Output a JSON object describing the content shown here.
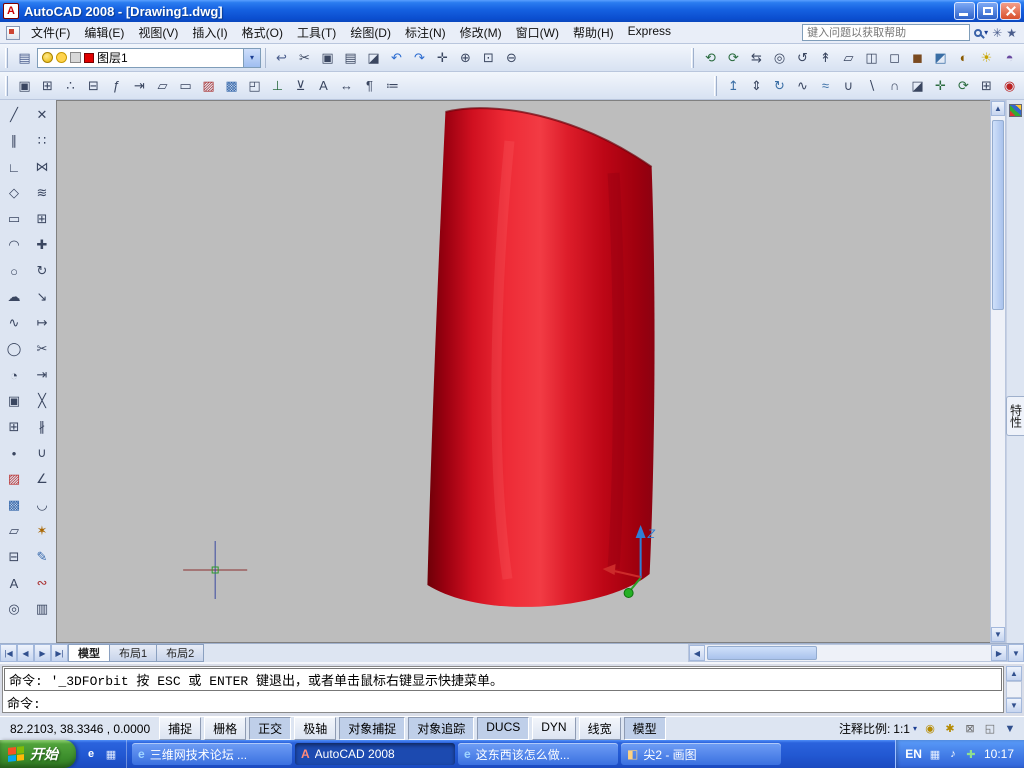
{
  "glyphs": {
    "up": "▲",
    "down": "▼",
    "left": "◀",
    "right": "▶",
    "caret": "▾"
  },
  "titlebar": {
    "app_icon_glyph": "A",
    "title": "AutoCAD 2008 - [Drawing1.dwg]"
  },
  "menubar": {
    "items": [
      {
        "name": "menu-file",
        "label": "文件(F)"
      },
      {
        "name": "menu-edit",
        "label": "编辑(E)"
      },
      {
        "name": "menu-view",
        "label": "视图(V)"
      },
      {
        "name": "menu-insert",
        "label": "插入(I)"
      },
      {
        "name": "menu-format",
        "label": "格式(O)"
      },
      {
        "name": "menu-tools",
        "label": "工具(T)"
      },
      {
        "name": "menu-draw",
        "label": "绘图(D)"
      },
      {
        "name": "menu-dimension",
        "label": "标注(N)"
      },
      {
        "name": "menu-modify",
        "label": "修改(M)"
      },
      {
        "name": "menu-window",
        "label": "窗口(W)"
      },
      {
        "name": "menu-help",
        "label": "帮助(H)"
      },
      {
        "name": "menu-express",
        "label": "Express"
      }
    ],
    "help_search_placeholder": "键入问题以获取帮助",
    "comm_center_glyph": "✳",
    "favorites_glyph": "★"
  },
  "toolbar1": {
    "left_icons": [
      {
        "name": "layer-properties-manager-icon",
        "glyph": "▤",
        "color": "#4a5d8c"
      }
    ],
    "layer_dropdown": {
      "value": "图层1"
    },
    "mid_icons": [
      {
        "name": "layer-previous-icon",
        "glyph": "↩",
        "color": "#4a5d8c"
      },
      {
        "name": "cut-icon",
        "glyph": "✂"
      },
      {
        "name": "copy-icon",
        "glyph": "▣"
      },
      {
        "name": "paste-icon",
        "glyph": "▤"
      },
      {
        "name": "match-properties-icon",
        "glyph": "◪"
      },
      {
        "name": "undo-icon",
        "glyph": "↶",
        "color": "#2b6bd0"
      },
      {
        "name": "redo-icon",
        "glyph": "↷",
        "color": "#2b6bd0"
      },
      {
        "name": "pan-icon",
        "glyph": "✛"
      },
      {
        "name": "zoom-realtime-icon",
        "glyph": "⊕"
      },
      {
        "name": "zoom-window-icon",
        "glyph": "⊡"
      },
      {
        "name": "zoom-previous-icon",
        "glyph": "⊖"
      }
    ],
    "right_icons": [
      {
        "name": "3d-orbit-icon",
        "glyph": "⟲",
        "color": "#2a6b3f"
      },
      {
        "name": "constrained-orbit-icon",
        "glyph": "⟳",
        "color": "#2a6b3f"
      },
      {
        "name": "3d-pan-icon",
        "glyph": "⇆"
      },
      {
        "name": "3d-zoom-icon",
        "glyph": "◎"
      },
      {
        "name": "3d-swivel-icon",
        "glyph": "↺"
      },
      {
        "name": "3d-walk-icon",
        "glyph": "↟"
      },
      {
        "name": "visual-style-2d-wireframe-icon",
        "glyph": "▱"
      },
      {
        "name": "visual-style-3d-wireframe-icon",
        "glyph": "◫"
      },
      {
        "name": "visual-style-hidden-icon",
        "glyph": "◻"
      },
      {
        "name": "visual-style-realistic-icon",
        "glyph": "◼",
        "color": "#7a4a20"
      },
      {
        "name": "visual-style-conceptual-icon",
        "glyph": "◩",
        "color": "#3a6ea5"
      },
      {
        "name": "render-icon",
        "glyph": "◐",
        "color": "#8a5a00"
      },
      {
        "name": "lights-icon",
        "glyph": "☀",
        "color": "#c8a400"
      },
      {
        "name": "materials-icon",
        "glyph": "◓",
        "color": "#6a4aa0"
      }
    ]
  },
  "toolbar2": {
    "left_icons": [
      {
        "name": "insert-block-icon",
        "glyph": "▣"
      },
      {
        "name": "make-block-icon",
        "glyph": "⊞"
      },
      {
        "name": "point-style-icon",
        "glyph": "∴"
      },
      {
        "name": "table-icon",
        "glyph": "⊟"
      },
      {
        "name": "field-icon",
        "glyph": "ƒ"
      },
      {
        "name": "distance-icon",
        "glyph": "⇥"
      },
      {
        "name": "area-icon",
        "glyph": "▱"
      },
      {
        "name": "region-icon",
        "glyph": "▭"
      },
      {
        "name": "hatch-icon",
        "glyph": "▨",
        "color": "#a33"
      },
      {
        "name": "gradient-icon",
        "glyph": "▩",
        "color": "#36a"
      },
      {
        "name": "boundary-icon",
        "glyph": "◰"
      },
      {
        "name": "ucs-icon",
        "glyph": "⊥",
        "color": "#2a6b3f"
      },
      {
        "name": "named-ucs-icon",
        "glyph": "⊻"
      },
      {
        "name": "text-style-icon",
        "glyph": "A"
      },
      {
        "name": "dim-style-icon",
        "glyph": "↔"
      },
      {
        "name": "mtext-icon",
        "glyph": "¶"
      },
      {
        "name": "properties-icon",
        "glyph": "≔"
      }
    ],
    "right_icons": [
      {
        "name": "extrude-icon",
        "glyph": "↥",
        "color": "#3a6ea5"
      },
      {
        "name": "presspull-icon",
        "glyph": "⇕"
      },
      {
        "name": "revolve-icon",
        "glyph": "↻",
        "color": "#3a6ea5"
      },
      {
        "name": "sweep-icon",
        "glyph": "∿"
      },
      {
        "name": "loft-icon",
        "glyph": "≈",
        "color": "#3a6ea5"
      },
      {
        "name": "union-icon",
        "glyph": "∪"
      },
      {
        "name": "subtract-icon",
        "glyph": "∖"
      },
      {
        "name": "intersect-icon",
        "glyph": "∩"
      },
      {
        "name": "slice-icon",
        "glyph": "◪"
      },
      {
        "name": "3d-move-icon",
        "glyph": "✛",
        "color": "#2a6b3f"
      },
      {
        "name": "3d-rotate-icon",
        "glyph": "⟳",
        "color": "#2a6b3f"
      },
      {
        "name": "3d-array-icon",
        "glyph": "⊞"
      },
      {
        "name": "render-materials-icon",
        "glyph": "◉",
        "color": "#b22"
      }
    ]
  },
  "left_toolbar": {
    "draw": [
      {
        "name": "line-icon",
        "glyph": "╱"
      },
      {
        "name": "construction-line-icon",
        "glyph": "∥"
      },
      {
        "name": "polyline-icon",
        "glyph": "∟"
      },
      {
        "name": "polygon-icon",
        "glyph": "◇"
      },
      {
        "name": "rectangle-icon",
        "glyph": "▭"
      },
      {
        "name": "arc-icon",
        "glyph": "◠"
      },
      {
        "name": "circle-icon",
        "glyph": "○"
      },
      {
        "name": "revision-cloud-icon",
        "glyph": "☁"
      },
      {
        "name": "spline-icon",
        "glyph": "∿"
      },
      {
        "name": "ellipse-icon",
        "glyph": "◯"
      },
      {
        "name": "ellipse-arc-icon",
        "glyph": "◔"
      },
      {
        "name": "insert-block-icon",
        "glyph": "▣"
      },
      {
        "name": "make-block-icon",
        "glyph": "⊞"
      },
      {
        "name": "point-icon",
        "glyph": "•"
      },
      {
        "name": "hatch-icon",
        "glyph": "▨",
        "color": "#b33"
      },
      {
        "name": "gradient-icon",
        "glyph": "▩",
        "color": "#36a"
      },
      {
        "name": "region-icon",
        "glyph": "▱"
      },
      {
        "name": "table-icon",
        "glyph": "⊟"
      },
      {
        "name": "mtext-icon",
        "glyph": "A"
      },
      {
        "name": "donut-icon",
        "glyph": "◎"
      }
    ],
    "modify": [
      {
        "name": "erase-icon",
        "glyph": "✕"
      },
      {
        "name": "copy-icon",
        "glyph": "∷"
      },
      {
        "name": "mirror-icon",
        "glyph": "⋈"
      },
      {
        "name": "offset-icon",
        "glyph": "≋"
      },
      {
        "name": "array-icon",
        "glyph": "⊞"
      },
      {
        "name": "move-icon",
        "glyph": "✚"
      },
      {
        "name": "rotate-icon",
        "glyph": "↻"
      },
      {
        "name": "scale-icon",
        "glyph": "↘"
      },
      {
        "name": "stretch-icon",
        "glyph": "↦"
      },
      {
        "name": "trim-icon",
        "glyph": "✂"
      },
      {
        "name": "extend-icon",
        "glyph": "⇥"
      },
      {
        "name": "break-at-point-icon",
        "glyph": "╳"
      },
      {
        "name": "break-icon",
        "glyph": "∦"
      },
      {
        "name": "join-icon",
        "glyph": "∪"
      },
      {
        "name": "chamfer-icon",
        "glyph": "∠"
      },
      {
        "name": "fillet-icon",
        "glyph": "◡"
      },
      {
        "name": "explode-icon",
        "glyph": "✶",
        "color": "#a60"
      },
      {
        "name": "edit-polyline-icon",
        "glyph": "✎",
        "color": "#36a"
      },
      {
        "name": "edit-spline-icon",
        "glyph": "∾",
        "color": "#a33"
      },
      {
        "name": "draworder-icon",
        "glyph": "▥"
      }
    ]
  },
  "canvas": {
    "ucs_z_label": "Z"
  },
  "right_panel": {
    "tab_label": "特性"
  },
  "layout_tabs": {
    "nav": [
      {
        "name": "tab-nav-first",
        "glyph": "|◀"
      },
      {
        "name": "tab-nav-prev",
        "glyph": "◀"
      },
      {
        "name": "tab-nav-next",
        "glyph": "▶"
      },
      {
        "name": "tab-nav-last",
        "glyph": "▶|"
      }
    ],
    "items": [
      {
        "name": "tab-model",
        "label": "模型",
        "active": true
      },
      {
        "name": "tab-layout1",
        "label": "布局1"
      },
      {
        "name": "tab-layout2",
        "label": "布局2"
      }
    ]
  },
  "command": {
    "history_line": "命令: '_3DFOrbit 按 ESC 或 ENTER 键退出，或者单击鼠标右键显示快捷菜单。",
    "prompt_line": "命令:"
  },
  "statusbar": {
    "coords": "82.2103, 38.3346 , 0.0000",
    "toggles": [
      {
        "name": "toggle-snap",
        "label": "捕捉",
        "active": false
      },
      {
        "name": "toggle-grid",
        "label": "栅格",
        "active": false
      },
      {
        "name": "toggle-ortho",
        "label": "正交",
        "active": true
      },
      {
        "name": "toggle-polar",
        "label": "极轴",
        "active": false
      },
      {
        "name": "toggle-osnap",
        "label": "对象捕捉",
        "active": true
      },
      {
        "name": "toggle-otrack",
        "label": "对象追踪",
        "active": true
      },
      {
        "name": "toggle-ducs",
        "label": "DUCS",
        "active": true
      },
      {
        "name": "toggle-dyn",
        "label": "DYN",
        "active": false
      },
      {
        "name": "toggle-lineweight",
        "label": "线宽",
        "active": false
      },
      {
        "name": "toggle-model-space",
        "label": "模型",
        "active": true
      }
    ],
    "annotation_scale_label": "注释比例:",
    "annotation_scale_value": "1:1",
    "icons": [
      {
        "name": "annotation-visibility-icon",
        "glyph": "◉",
        "color": "#b58a00"
      },
      {
        "name": "annotation-autoscale-icon",
        "glyph": "✱",
        "color": "#b58a00"
      },
      {
        "name": "toolbar-lock-icon",
        "glyph": "⊠",
        "color": "#666"
      },
      {
        "name": "clean-screen-icon",
        "glyph": "◱",
        "color": "#666"
      },
      {
        "name": "status-tray-menu-icon",
        "glyph": "▼",
        "color": "#31508e"
      }
    ]
  },
  "taskbar": {
    "start_label": "开始",
    "quick_launch": [
      {
        "name": "quick-launch-ie-icon",
        "glyph": "e",
        "color": "#ffffff"
      },
      {
        "name": "quick-launch-show-desktop-icon",
        "glyph": "▦",
        "color": "#dfeaff"
      }
    ],
    "tasks": [
      {
        "name": "task-forum",
        "label": "三维网技术论坛 ...",
        "icon": "e",
        "color": "#9fd4ff",
        "active": false
      },
      {
        "name": "task-autocad",
        "label": "AutoCAD 2008",
        "icon": "A",
        "color": "#ff8a7a",
        "active": true
      },
      {
        "name": "task-question",
        "label": "这东西该怎么做...",
        "icon": "e",
        "color": "#9fd4ff",
        "active": false
      },
      {
        "name": "task-paint",
        "label": "尖2 - 画图",
        "icon": "◧",
        "color": "#ffd27f",
        "active": false
      }
    ],
    "tray": {
      "lang": "EN",
      "icons": [
        {
          "name": "ime-keyboard-icon",
          "glyph": "▦",
          "color": "#e8f0ff"
        },
        {
          "name": "volume-icon",
          "glyph": "♪",
          "color": "#ffffff"
        },
        {
          "name": "safety-icon",
          "glyph": "✚",
          "color": "#8fe08f"
        }
      ],
      "time": "10:17"
    }
  }
}
